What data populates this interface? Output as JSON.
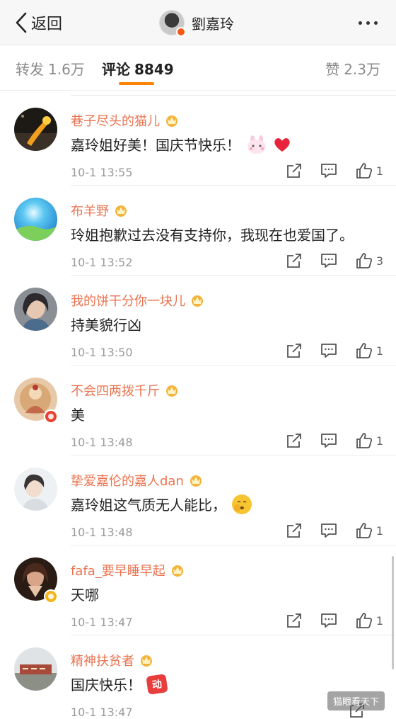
{
  "nav": {
    "back_label": "返回",
    "title": "劉嘉玲"
  },
  "tabs": {
    "repost_label": "转发",
    "repost_count": "1.6万",
    "comment_label": "评论",
    "comment_count": "8849",
    "like_label": "赞",
    "like_count": "2.3万"
  },
  "accent_color": "#ff8200",
  "username_color": "#eb7350",
  "comments": [
    {
      "username": "巷子尽头的猫儿",
      "text": "嘉玲姐好美！国庆节快乐！",
      "emoji": [
        "bunny-emoji",
        "red-heart-emoji"
      ],
      "time": "10-1 13:55",
      "likes": "1"
    },
    {
      "username": "布羊野",
      "text": "玲姐抱歉过去没有支持你，我现在也爱国了。",
      "emoji": [],
      "time": "10-1 13:52",
      "likes": "3"
    },
    {
      "username": "我的饼干分你一块儿",
      "text": "持美貌行凶",
      "emoji": [],
      "time": "10-1 13:50",
      "likes": "1"
    },
    {
      "username": "不会四两拨千斤",
      "text": "美",
      "emoji": [],
      "time": "10-1 13:48",
      "likes": "1"
    },
    {
      "username": "挚爱嘉伦的嘉人dan",
      "text": "嘉玲姐这气质无人能比，",
      "emoji": [
        "shy-face-emoji"
      ],
      "time": "10-1 13:48",
      "likes": "1"
    },
    {
      "username": "fafa_要早睡早起",
      "text": "天哪",
      "emoji": [],
      "time": "10-1 13:47",
      "likes": "1"
    },
    {
      "username": "精神扶贫者",
      "text": "国庆快乐！",
      "emoji": [
        "sticker-emoji"
      ],
      "sticker_text": "动",
      "time": "10-1 13:47",
      "likes": ""
    }
  ],
  "watermark": "猫眼看天下"
}
